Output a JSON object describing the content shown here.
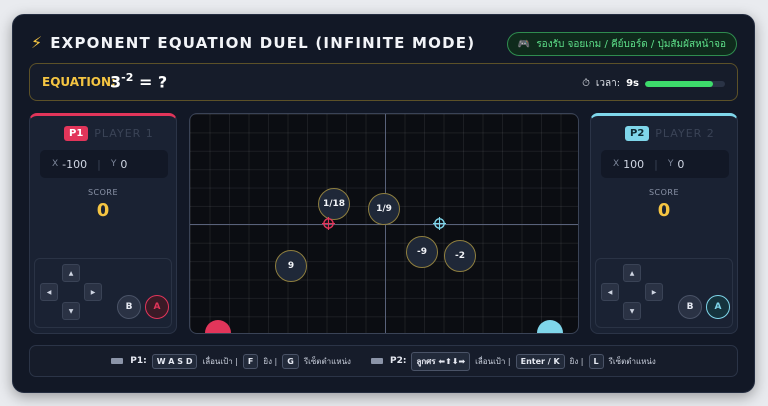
{
  "header": {
    "icon": "lightning-bolt-icon",
    "title": "EXPONENT EQUATION DUEL (INFINITE MODE)",
    "status": "รองรับ จอยเกม / คีย์บอร์ด / ปุ่มสัมผัสหน้าจอ",
    "status_icon": "gamepad-icon"
  },
  "equation": {
    "label": "EQUATION:",
    "base": "3",
    "exponent": "-2",
    "rest": " = ?"
  },
  "timer": {
    "icon": "stopwatch-icon",
    "label": "เวลา:",
    "value": "9s",
    "fraction": 0.85
  },
  "players": [
    {
      "badge": "P1",
      "name": "PLAYER 1",
      "x_label": "X",
      "x_value": "-100",
      "y_label": "Y",
      "y_value": "0",
      "score_label": "SCORE",
      "score": "0",
      "btn_b": "B",
      "btn_a": "A",
      "color": "#e2355a"
    },
    {
      "badge": "P2",
      "name": "PLAYER 2",
      "x_label": "X",
      "x_value": "100",
      "y_label": "Y",
      "y_value": "0",
      "score_label": "SCORE",
      "score": "0",
      "btn_b": "B",
      "btn_a": "A",
      "color": "#7fd6ea"
    }
  ],
  "arena": {
    "bubbles": [
      "1/18",
      "1/9",
      "-9",
      "-2",
      "9"
    ]
  },
  "controls": {
    "p1_label": "P1:",
    "p1_move_key": "W A S D",
    "move_text": "เลื่อนเป้า |",
    "p1_fire_key": "F",
    "fire_text": "ยิง |",
    "p1_reset_key": "G",
    "reset_text": "รีเซ็ตตำแหน่ง",
    "p2_label": "P2:",
    "p2_move_key": "ลูกศร ⬅⬆⬇➡",
    "p2_fire_key": "Enter / K",
    "p2_reset_key": "L"
  }
}
